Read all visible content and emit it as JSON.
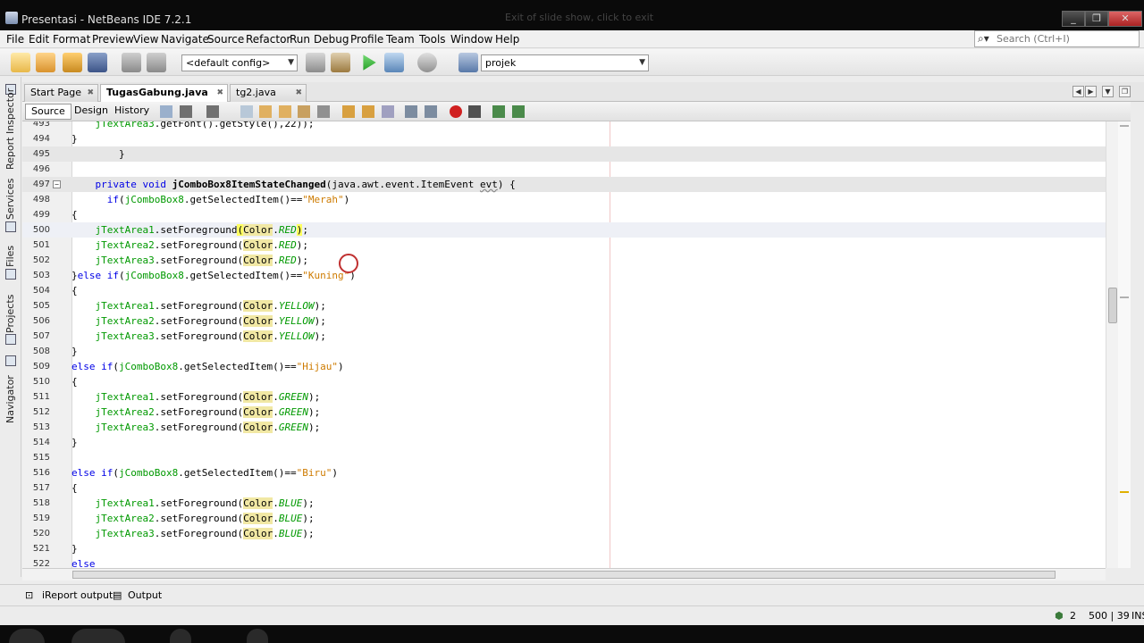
{
  "window": {
    "title": "Presentasi - NetBeans IDE 7.2.1",
    "faded_text": "Exit of slide show, click to exit",
    "controls": [
      "_",
      "❐",
      "✕"
    ]
  },
  "menu": [
    "File",
    "Edit",
    "Format",
    "Preview",
    "View",
    "Navigate",
    "Source",
    "Refactor",
    "Run",
    "Debug",
    "Profile",
    "Team",
    "Tools",
    "Window",
    "Help"
  ],
  "search": {
    "placeholder": "Search (Ctrl+I)"
  },
  "toolbar": {
    "config": "<default config>",
    "project": "projek"
  },
  "sidebar": {
    "items": [
      "Report Inspector",
      "Services",
      "Files",
      "Projects",
      "Navigator"
    ]
  },
  "tabs": [
    {
      "label": "Start Page",
      "active": false
    },
    {
      "label": "TugasGabung.java",
      "active": true
    },
    {
      "label": "tg2.java",
      "active": false
    }
  ],
  "editor_tabs": {
    "source": "Source",
    "design": "Design",
    "history": "History"
  },
  "editor": {
    "lines": [
      {
        "n": "493",
        "text": "    jTextArea3.getFont().getStyle(),22));"
      },
      {
        "n": "494",
        "text": "}"
      },
      {
        "n": "495",
        "text": "        }"
      },
      {
        "n": "496",
        "text": ""
      },
      {
        "n": "497",
        "text": "    private void jComboBox8ItemStateChanged(java.awt.event.ItemEvent evt) {"
      },
      {
        "n": "498",
        "text": "      if(jComboBox8.getSelectedItem()==\"Merah\")"
      },
      {
        "n": "499",
        "text": "{"
      },
      {
        "n": "500",
        "text": "    jTextArea1.setForeground(Color.RED);"
      },
      {
        "n": "501",
        "text": "    jTextArea2.setForeground(Color.RED);"
      },
      {
        "n": "502",
        "text": "    jTextArea3.setForeground(Color.RED);"
      },
      {
        "n": "503",
        "text": "}else if(jComboBox8.getSelectedItem()==\"Kuning\")"
      },
      {
        "n": "504",
        "text": "{"
      },
      {
        "n": "505",
        "text": "    jTextArea1.setForeground(Color.YELLOW);"
      },
      {
        "n": "506",
        "text": "    jTextArea2.setForeground(Color.YELLOW);"
      },
      {
        "n": "507",
        "text": "    jTextArea3.setForeground(Color.YELLOW);"
      },
      {
        "n": "508",
        "text": "}"
      },
      {
        "n": "509",
        "text": "else if(jComboBox8.getSelectedItem()==\"Hijau\")"
      },
      {
        "n": "510",
        "text": "{"
      },
      {
        "n": "511",
        "text": "    jTextArea1.setForeground(Color.GREEN);"
      },
      {
        "n": "512",
        "text": "    jTextArea2.setForeground(Color.GREEN);"
      },
      {
        "n": "513",
        "text": "    jTextArea3.setForeground(Color.GREEN);"
      },
      {
        "n": "514",
        "text": "}"
      },
      {
        "n": "515",
        "text": ""
      },
      {
        "n": "516",
        "text": "else if(jComboBox8.getSelectedItem()==\"Biru\")"
      },
      {
        "n": "517",
        "text": "{"
      },
      {
        "n": "518",
        "text": "    jTextArea1.setForeground(Color.BLUE);"
      },
      {
        "n": "519",
        "text": "    jTextArea2.setForeground(Color.BLUE);"
      },
      {
        "n": "520",
        "text": "    jTextArea3.setForeground(Color.BLUE);"
      },
      {
        "n": "521",
        "text": "}"
      },
      {
        "n": "522",
        "text": "else"
      }
    ]
  },
  "bottom_tabs": {
    "ireport": "iReport output",
    "output": "Output"
  },
  "status": {
    "notifications": "2",
    "position": "500 | 39",
    "mode": "INS"
  },
  "colors": {
    "keyword": "#0000e6",
    "field": "#009900",
    "string": "#ce7b00",
    "class_highlight": "#f1e8a4"
  }
}
